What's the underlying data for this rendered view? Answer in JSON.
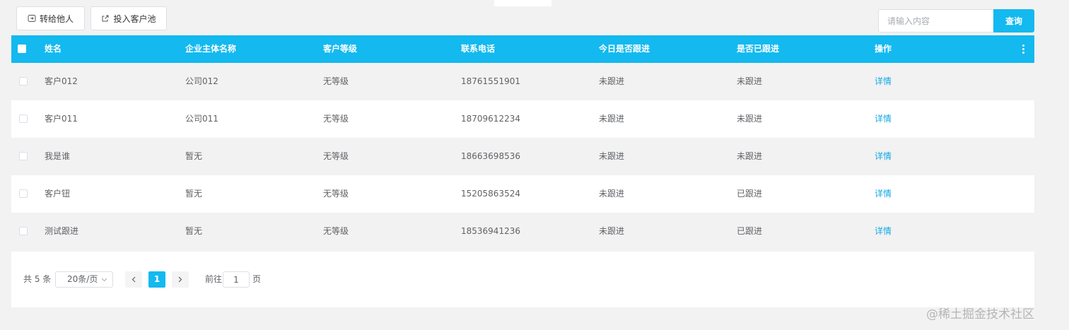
{
  "toolbar": {
    "transfer_label": "转给他人",
    "pool_label": "投入客户池"
  },
  "search": {
    "placeholder": "请输入内容",
    "value": "",
    "button_label": "查询"
  },
  "table": {
    "headers": {
      "name": "姓名",
      "company": "企业主体名称",
      "level": "客户等级",
      "phone": "联系电话",
      "today": "今日是否跟进",
      "followed": "是否已跟进",
      "op": "操作"
    },
    "rows": [
      {
        "name": "客户012",
        "company": "公司012",
        "level": "无等级",
        "phone": "18761551901",
        "today": "未跟进",
        "followed": "未跟进",
        "op": "详情"
      },
      {
        "name": "客户011",
        "company": "公司011",
        "level": "无等级",
        "phone": "18709612234",
        "today": "未跟进",
        "followed": "未跟进",
        "op": "详情"
      },
      {
        "name": "我是谁",
        "company": "暂无",
        "level": "无等级",
        "phone": "18663698536",
        "today": "未跟进",
        "followed": "未跟进",
        "op": "详情"
      },
      {
        "name": "客户钮",
        "company": "暂无",
        "level": "无等级",
        "phone": "15205863524",
        "today": "未跟进",
        "followed": "已跟进",
        "op": "详情"
      },
      {
        "name": "测试跟进",
        "company": "暂无",
        "level": "无等级",
        "phone": "18536941236",
        "today": "未跟进",
        "followed": "已跟进",
        "op": "详情"
      }
    ]
  },
  "pagination": {
    "total_label": "共 5 条",
    "page_size": "20条/页",
    "current_page": "1",
    "goto_prefix": "前往",
    "goto_value": "1",
    "goto_suffix": "页"
  },
  "watermark": "@稀土掘金技术社区",
  "colors": {
    "accent": "#13b9ef",
    "link": "#13a8e6"
  }
}
